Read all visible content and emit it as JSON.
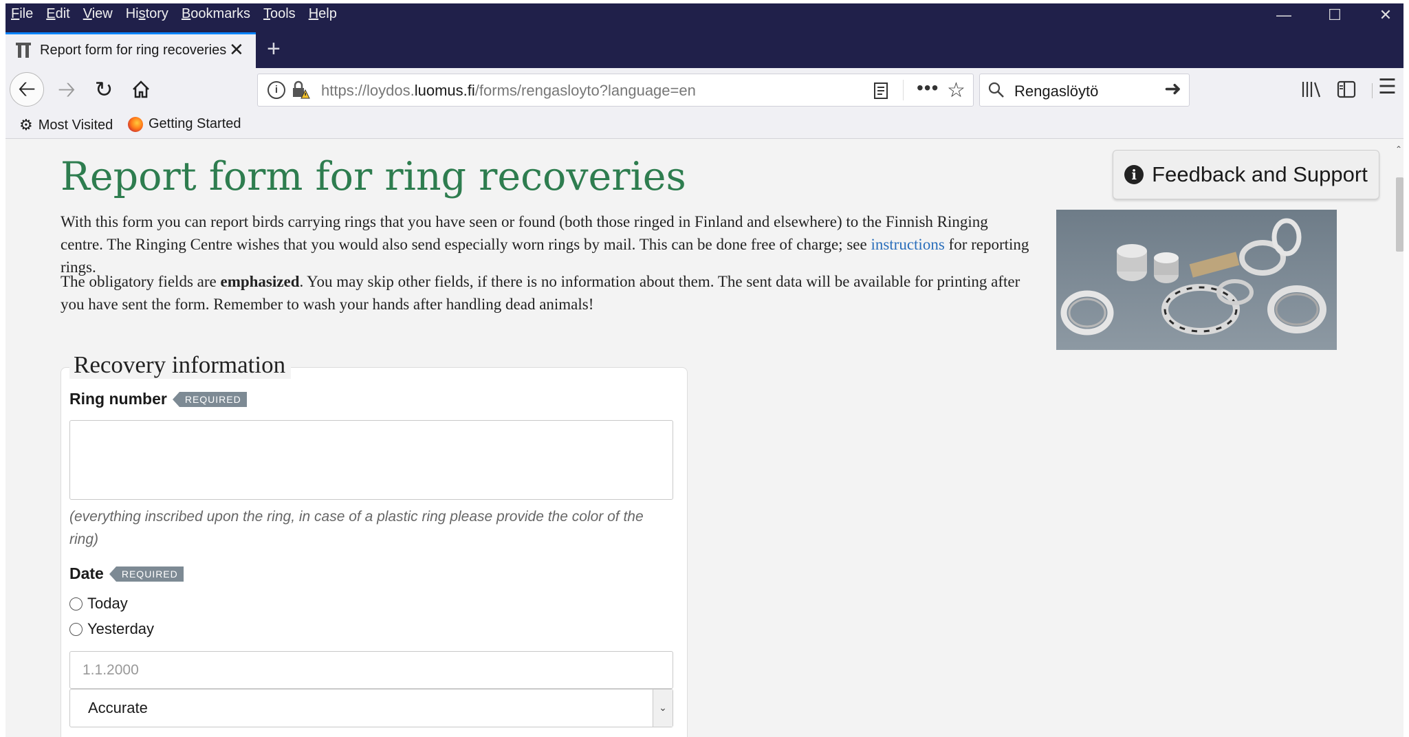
{
  "browser": {
    "menu": [
      "File",
      "Edit",
      "View",
      "History",
      "Bookmarks",
      "Tools",
      "Help"
    ],
    "menu_accel": [
      "F",
      "E",
      "V",
      "s",
      "B",
      "T",
      "H"
    ],
    "tab_title": "Report form for ring recoveries",
    "url_prefix": "https://loydos.",
    "url_domain": "luomus.fi",
    "url_path": "/forms/rengasloyto?language=en",
    "search_text": "Rengaslöytö",
    "bookmarks": [
      "Most Visited",
      "Getting Started"
    ]
  },
  "page": {
    "title": "Report form for ring recoveries",
    "feedback_label": "Feedback and Support",
    "intro_1_before": "With this form you can report birds carrying rings that you have seen or found (both those ringed in Finland and elsewhere) to the Finnish Ringing centre. The Ringing Centre wishes that you would also send especially worn rings by mail. This can be done free of charge; see ",
    "intro_1_link": "instructions",
    "intro_1_after": " for reporting rings.",
    "intro_2_before": "The obligatory fields are ",
    "intro_2_bold": "emphasized",
    "intro_2_after": ". You may skip other fields, if there is no information about them. The sent data will be available for printing after you have sent the form. Remember to wash your hands after handling dead animals!"
  },
  "form": {
    "legend": "Recovery information",
    "required_badge": "REQUIRED",
    "ring_number_label": "Ring number",
    "ring_number_value": "",
    "ring_number_help": "(everything inscribed upon the ring, in case of a plastic ring please provide the color of the ring)",
    "date_label": "Date",
    "date_options": [
      "Today",
      "Yesterday"
    ],
    "date_placeholder": "1.1.2000",
    "accuracy_value": "Accurate"
  },
  "colors": {
    "title_green": "#2e7d4f",
    "link_blue": "#2a6ebb",
    "titlebar": "#20204a",
    "badge": "#7d8a94"
  }
}
